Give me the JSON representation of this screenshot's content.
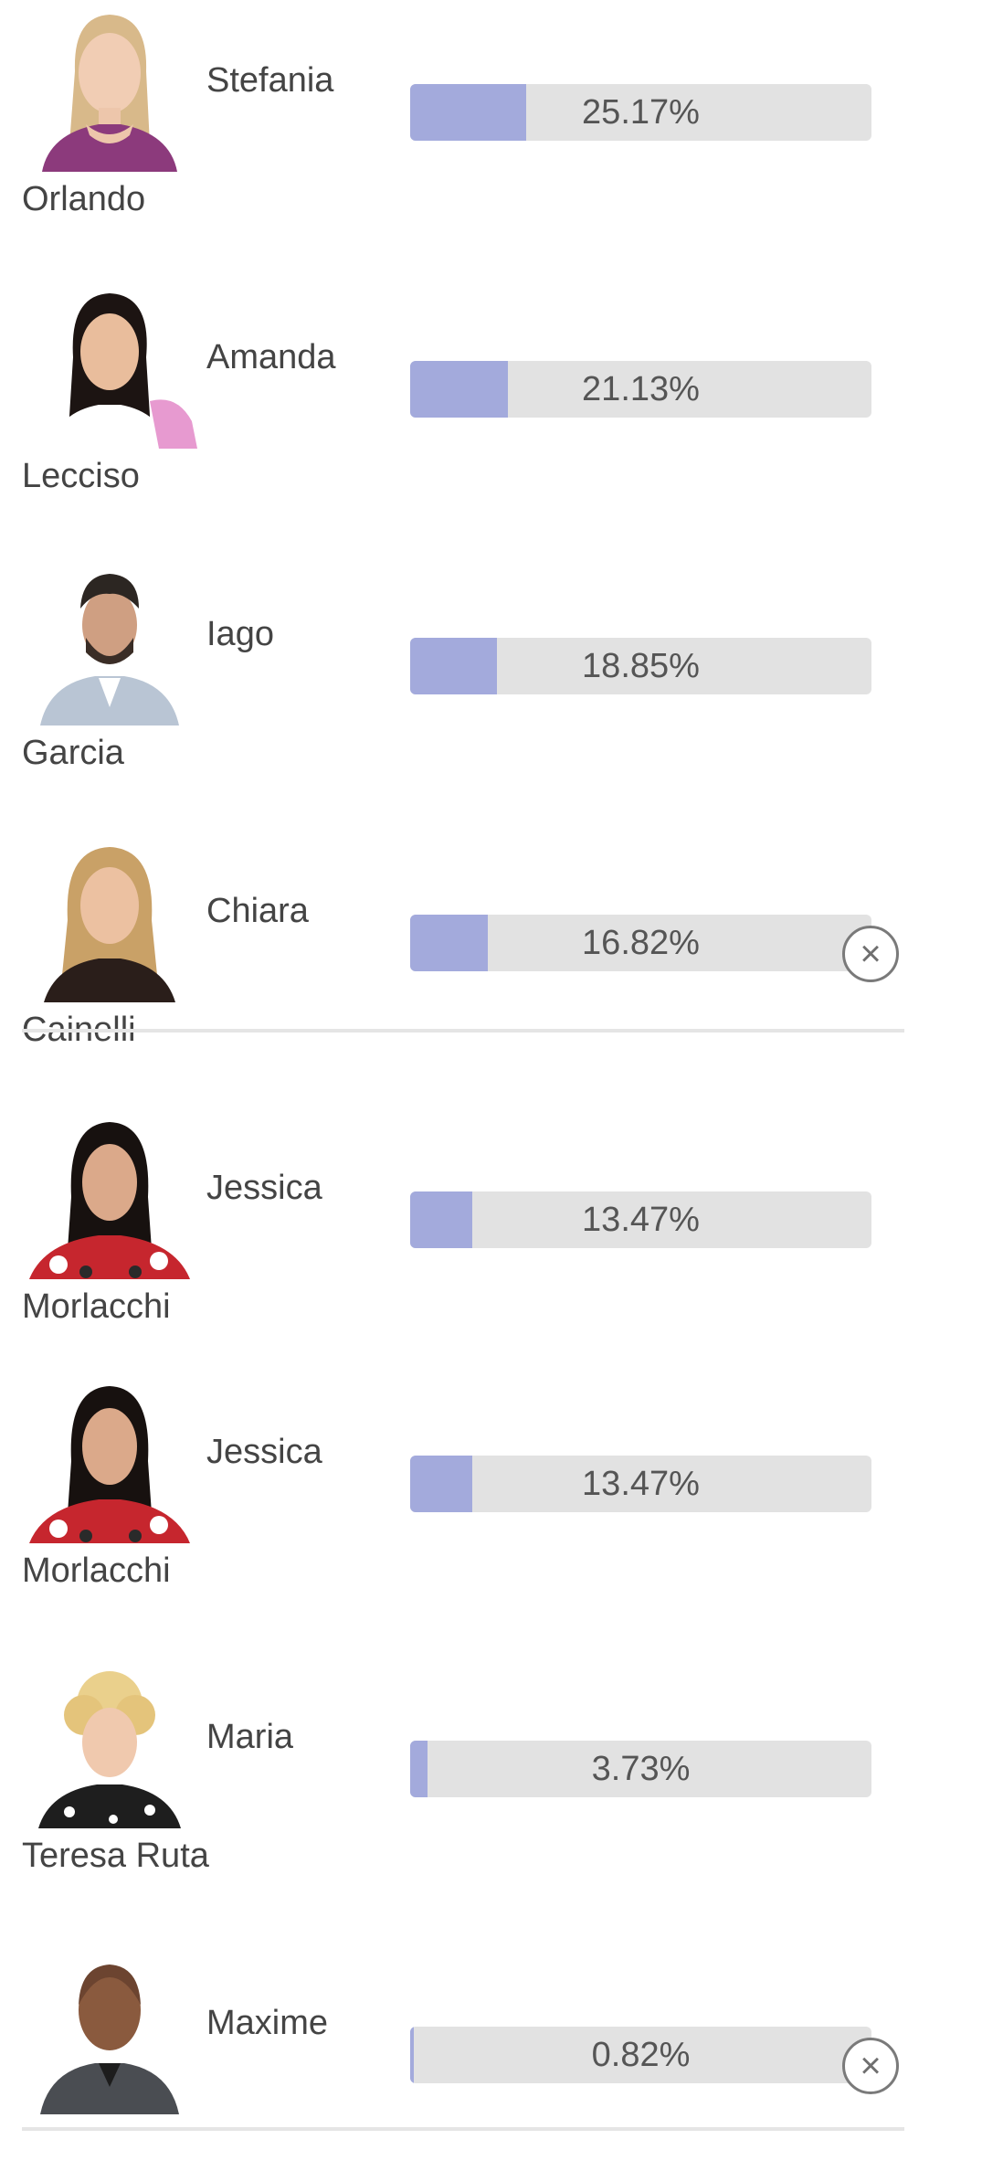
{
  "candidates": [
    {
      "first_name": "Stefania",
      "last_name": "Orlando",
      "percent_label": "25.17%",
      "percent": 25.17
    },
    {
      "first_name": "Amanda",
      "last_name": "Lecciso",
      "percent_label": "21.13%",
      "percent": 21.13
    },
    {
      "first_name": "Iago",
      "last_name": "Garcia",
      "percent_label": "18.85%",
      "percent": 18.85
    },
    {
      "first_name": "Chiara",
      "last_name": "Cainelli",
      "percent_label": "16.82%",
      "percent": 16.82
    },
    {
      "first_name": "Jessica",
      "last_name": "Morlacchi",
      "percent_label": "13.47%",
      "percent": 13.47
    },
    {
      "first_name": "Jessica",
      "last_name": "Morlacchi",
      "percent_label": "13.47%",
      "percent": 13.47
    },
    {
      "first_name": "Maria",
      "last_name": "Teresa Ruta",
      "percent_label": "3.73%",
      "percent": 3.73
    },
    {
      "first_name": "Maxime",
      "last_name": "",
      "percent_label": "0.82%",
      "percent": 0.82
    }
  ],
  "close_symbol": "×",
  "colors": {
    "bar_fill": "#a3aadc",
    "bar_track": "#e2e2e2",
    "text": "#444444"
  }
}
